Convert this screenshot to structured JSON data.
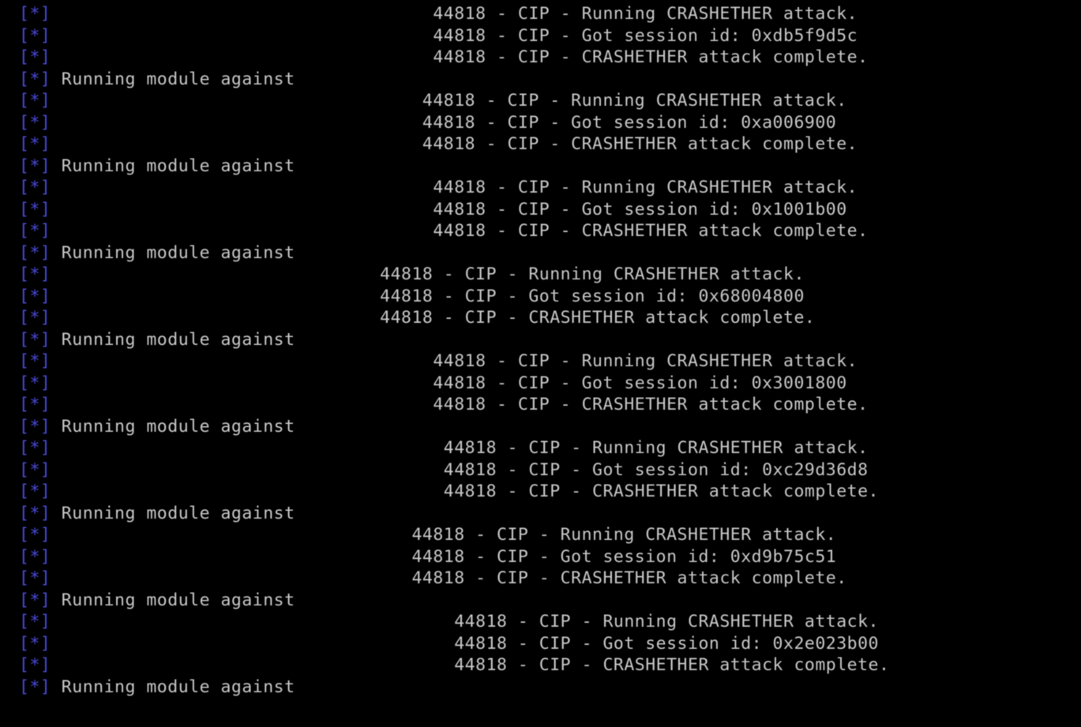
{
  "info_marker": {
    "open": "[",
    "star": "*",
    "close": "]"
  },
  "prefix": {
    "port": "44818",
    "sep1": " - ",
    "proto": "CIP",
    "sep2": " - "
  },
  "msg": {
    "running_attack": "Running CRASHETHER attack.",
    "got_session_prefix": "Got session id: ",
    "complete": "CRASHETHER attack complete.",
    "running_module": "Running module against"
  },
  "lines": [
    {
      "type": "status",
      "msg_key": "running_attack",
      "pad": 35
    },
    {
      "type": "status",
      "msg_key": "got_session",
      "pad": 35,
      "session": "0xdb5f9d5c"
    },
    {
      "type": "status",
      "msg_key": "complete",
      "pad": 35
    },
    {
      "type": "module"
    },
    {
      "type": "status",
      "msg_key": "running_attack",
      "pad": 34
    },
    {
      "type": "status",
      "msg_key": "got_session",
      "pad": 34,
      "session": "0xa006900"
    },
    {
      "type": "status",
      "msg_key": "complete",
      "pad": 34
    },
    {
      "type": "module"
    },
    {
      "type": "status",
      "msg_key": "running_attack",
      "pad": 35
    },
    {
      "type": "status",
      "msg_key": "got_session",
      "pad": 35,
      "session": "0x1001b00"
    },
    {
      "type": "status",
      "msg_key": "complete",
      "pad": 35
    },
    {
      "type": "module"
    },
    {
      "type": "status",
      "msg_key": "running_attack",
      "pad": 30
    },
    {
      "type": "status",
      "msg_key": "got_session",
      "pad": 30,
      "session": "0x68004800"
    },
    {
      "type": "status",
      "msg_key": "complete",
      "pad": 30
    },
    {
      "type": "module"
    },
    {
      "type": "status",
      "msg_key": "running_attack",
      "pad": 35
    },
    {
      "type": "status",
      "msg_key": "got_session",
      "pad": 35,
      "session": "0x3001800"
    },
    {
      "type": "status",
      "msg_key": "complete",
      "pad": 35
    },
    {
      "type": "module"
    },
    {
      "type": "status",
      "msg_key": "running_attack",
      "pad": 36
    },
    {
      "type": "status",
      "msg_key": "got_session",
      "pad": 36,
      "session": "0xc29d36d8"
    },
    {
      "type": "status",
      "msg_key": "complete",
      "pad": 36
    },
    {
      "type": "module"
    },
    {
      "type": "status",
      "msg_key": "running_attack",
      "pad": 33
    },
    {
      "type": "status",
      "msg_key": "got_session",
      "pad": 33,
      "session": "0xd9b75c51"
    },
    {
      "type": "status",
      "msg_key": "complete",
      "pad": 33
    },
    {
      "type": "module"
    },
    {
      "type": "status",
      "msg_key": "running_attack",
      "pad": 37
    },
    {
      "type": "status",
      "msg_key": "got_session",
      "pad": 37,
      "session": "0x2e023b00"
    },
    {
      "type": "status",
      "msg_key": "complete",
      "pad": 37
    },
    {
      "type": "module"
    }
  ]
}
